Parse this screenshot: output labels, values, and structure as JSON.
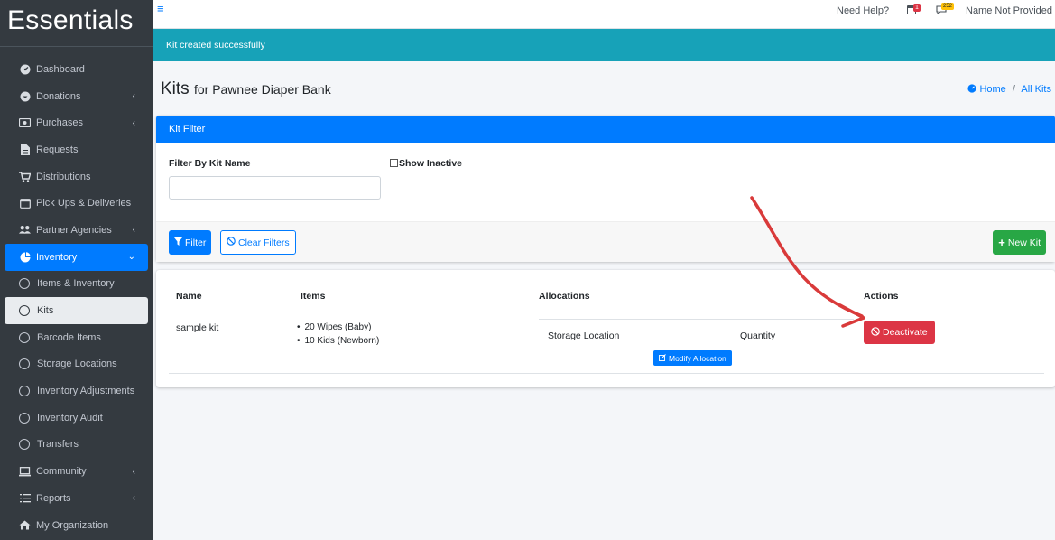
{
  "brand": "Essentials",
  "sidebar": {
    "items": [
      {
        "label": "Dashboard",
        "icon": "dashboard-icon"
      },
      {
        "label": "Donations",
        "icon": "donations-icon"
      },
      {
        "label": "Purchases",
        "icon": "purchases-icon"
      },
      {
        "label": "Requests",
        "icon": "requests-icon"
      },
      {
        "label": "Distributions",
        "icon": "cart-icon"
      },
      {
        "label": "Pick Ups & Deliveries",
        "icon": "calendar-icon"
      },
      {
        "label": "Partner Agencies",
        "icon": "users-icon"
      },
      {
        "label": "Inventory",
        "icon": "pie-icon"
      },
      {
        "label": "Items & Inventory"
      },
      {
        "label": "Kits"
      },
      {
        "label": "Barcode Items"
      },
      {
        "label": "Storage Locations"
      },
      {
        "label": "Inventory Adjustments"
      },
      {
        "label": "Inventory Audit"
      },
      {
        "label": "Transfers"
      },
      {
        "label": "Community",
        "icon": "laptop-icon"
      },
      {
        "label": "Reports",
        "icon": "list-icon"
      },
      {
        "label": "My Organization",
        "icon": "home-icon"
      }
    ]
  },
  "topbar": {
    "help": "Need Help?",
    "calendar_badge": "1",
    "messages_badge": "252",
    "user": "Name Not Provided"
  },
  "alert": {
    "text": "Kit created successfully"
  },
  "page": {
    "title": "Kits",
    "subtitle": "for Pawnee Diaper Bank"
  },
  "breadcrumb": {
    "home": "Home",
    "separator": "/",
    "current": "All Kits"
  },
  "filter": {
    "header": "Kit Filter",
    "name_label": "Filter By Kit Name",
    "name_value": "",
    "show_inactive_label": "Show Inactive",
    "filter_button": "Filter",
    "clear_button": "Clear Filters",
    "new_button": "New Kit"
  },
  "table": {
    "columns": [
      "Name",
      "Items",
      "Allocations",
      "Actions"
    ],
    "rows": [
      {
        "name": "sample kit",
        "items": [
          "20 Wipes (Baby)",
          "10 Kids (Newborn)"
        ],
        "alloc_location_header": "Storage Location",
        "alloc_quantity_header": "Quantity",
        "modify_button": "Modify Allocation",
        "deactivate_button": "Deactivate"
      }
    ]
  },
  "colors": {
    "primary": "#007bff",
    "success": "#28a745",
    "danger": "#dc3545",
    "info": "#17a2b8",
    "sidebar": "#343a40",
    "annotation_arrow": "#d93a3a"
  }
}
